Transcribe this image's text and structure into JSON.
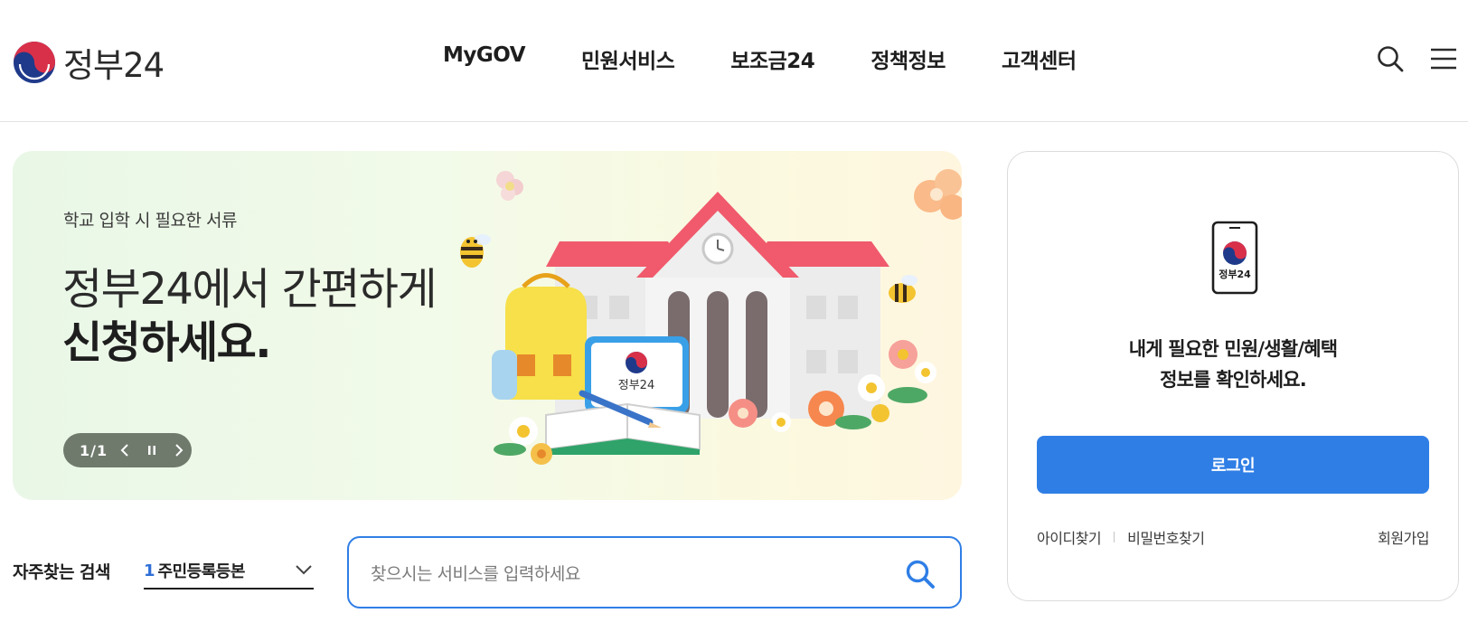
{
  "header": {
    "logo_text": "정부24",
    "nav": [
      {
        "label": "MyGOV"
      },
      {
        "label": "민원서비스"
      },
      {
        "label": "보조금24"
      },
      {
        "label": "정책정보"
      },
      {
        "label": "고객센터"
      }
    ]
  },
  "banner": {
    "subtitle": "학교 입학 시 필요한 서류",
    "title_line1": "정부24에서 간편하게",
    "title_line2": "신청하세요.",
    "counter": "1/1",
    "illustration_badge": "정부24"
  },
  "search": {
    "freq_label": "자주찾는 검색",
    "freq_rank": "1",
    "freq_value": "주민등록등본",
    "placeholder": "찾으시는 서비스를 입력하세요"
  },
  "login": {
    "phone_label": "정부24",
    "message_line1": "내게 필요한 민원/생활/혜택",
    "message_line2": "정보를 확인하세요.",
    "login_label": "로그인",
    "find_id": "아이디찾기",
    "find_password": "비밀번호찾기",
    "signup": "회원가입"
  },
  "colors": {
    "accent": "#2f7ee6",
    "logo_red": "#d9304a",
    "logo_blue": "#1f3a8a"
  }
}
